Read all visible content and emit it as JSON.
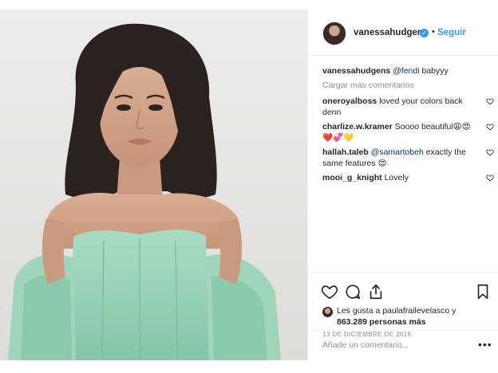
{
  "post": {
    "photo_alt": "",
    "header": {
      "username": "vanessahudgens",
      "separator": "•",
      "follow_label": "Seguir"
    },
    "caption": {
      "username": "vanessahudgens",
      "mention": "@fendi",
      "text": " babyyy"
    },
    "load_more_label": "Cargar más comentarios",
    "comments": [
      {
        "username": "oneroyalboss",
        "text": " loved your colors back denn",
        "mention": ""
      },
      {
        "username": "charlize.w.kramer",
        "text": " Soooo beautiful😩😍❤️💞💛",
        "mention": ""
      },
      {
        "username": "hallah.taleb",
        "mention": " @samartobeh",
        "text": " exactly the same features 😍"
      },
      {
        "username": "mooi_g_knight",
        "text": " Lovely",
        "mention": ""
      }
    ],
    "likes": {
      "line1": "Les gusta a paulafrailevelasco y",
      "line2": "863.289 personas más"
    },
    "date": "13 DE DICIEMBRE DE 2018",
    "add_comment_placeholder": "Añade un comentario...",
    "more_label": "•••",
    "icons": [
      "heart-icon",
      "comment-icon",
      "share-icon",
      "bookmark-icon",
      "verified-badge-icon"
    ]
  }
}
